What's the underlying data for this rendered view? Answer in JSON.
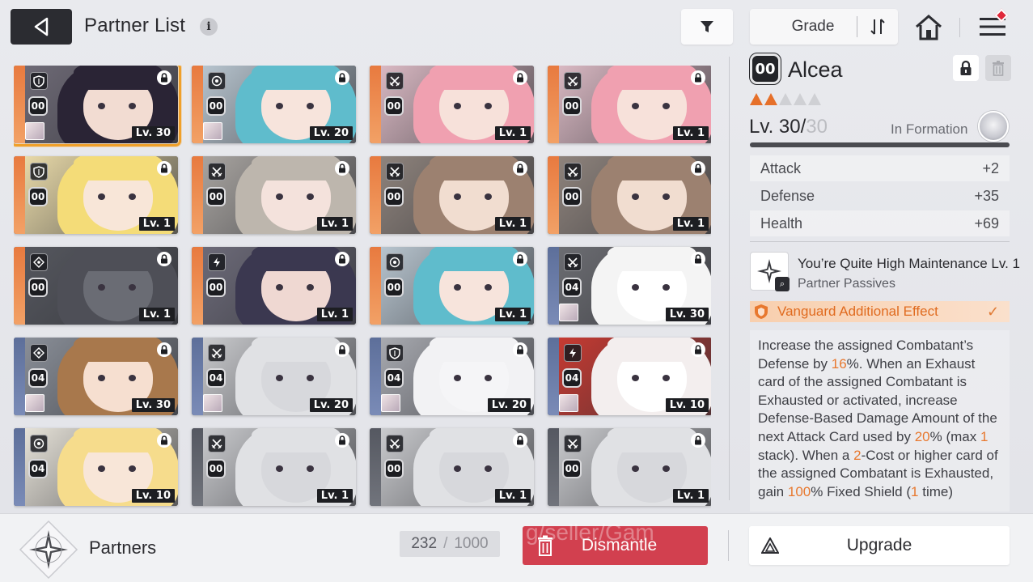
{
  "header": {
    "title": "Partner List",
    "info_glyph": "i",
    "sort_label": "Grade"
  },
  "colors": {
    "accent_orange": "#e8782e",
    "selected_outline": "#f0a02a",
    "dismantle_red": "#d2404f",
    "dark": "#2b2c31"
  },
  "grid": {
    "cards": [
      {
        "class_icon": "shield-icon",
        "grade": "00",
        "level": "Lv. 30",
        "locked": true,
        "selected": true,
        "strip": "orange",
        "avatar": true,
        "hair": "#2a2435",
        "skin": "#f2dcd2",
        "bg": "#6e6a76"
      },
      {
        "class_icon": "target-icon",
        "grade": "00",
        "level": "Lv. 20",
        "locked": true,
        "selected": false,
        "strip": "orange",
        "avatar": true,
        "hair": "#5fbccc",
        "skin": "#f7e4dc",
        "bg": "#b7c4ce"
      },
      {
        "class_icon": "swords-icon",
        "grade": "00",
        "level": "Lv. 1",
        "locked": true,
        "selected": false,
        "strip": "orange",
        "avatar": false,
        "hair": "#f0a0b0",
        "skin": "#f7e1da",
        "bg": "#d9b8c2"
      },
      {
        "class_icon": "swords-icon",
        "grade": "00",
        "level": "Lv. 1",
        "locked": true,
        "selected": false,
        "strip": "orange",
        "avatar": false,
        "hair": "#f0a0b0",
        "skin": "#f7e1da",
        "bg": "#d9b8c2"
      },
      {
        "class_icon": "shield-icon",
        "grade": "00",
        "level": "Lv. 1",
        "locked": true,
        "selected": false,
        "strip": "orange",
        "avatar": false,
        "hair": "#f4dc78",
        "skin": "#f8e6d8",
        "bg": "#e8d9a8"
      },
      {
        "class_icon": "swords-icon",
        "grade": "00",
        "level": "Lv. 1",
        "locked": true,
        "selected": false,
        "strip": "orange",
        "avatar": false,
        "hair": "#bdb6ad",
        "skin": "#f4e2dc",
        "bg": "#a8a4a0"
      },
      {
        "class_icon": "swords-icon",
        "grade": "00",
        "level": "Lv. 1",
        "locked": true,
        "selected": false,
        "strip": "orange",
        "avatar": false,
        "hair": "#9c8170",
        "skin": "#f1ddd0",
        "bg": "#8e837c"
      },
      {
        "class_icon": "swords-icon",
        "grade": "00",
        "level": "Lv. 1",
        "locked": true,
        "selected": false,
        "strip": "orange",
        "avatar": false,
        "hair": "#9c8170",
        "skin": "#f1ddd0",
        "bg": "#8e837c"
      },
      {
        "class_icon": "crosshair-icon",
        "grade": "00",
        "level": "Lv. 1",
        "locked": true,
        "selected": false,
        "strip": "orange",
        "avatar": false,
        "hair": "#4e4f57",
        "skin": "#6a6c74",
        "bg": "#55575e"
      },
      {
        "class_icon": "lightning-icon",
        "grade": "00",
        "level": "Lv. 1",
        "locked": true,
        "selected": false,
        "strip": "orange",
        "avatar": false,
        "hair": "#3b3850",
        "skin": "#efd8d2",
        "bg": "#6c6a78"
      },
      {
        "class_icon": "target-icon",
        "grade": "00",
        "level": "Lv. 1",
        "locked": true,
        "selected": false,
        "strip": "orange",
        "avatar": false,
        "hair": "#5fbccc",
        "skin": "#f7e4dc",
        "bg": "#b7c4ce"
      },
      {
        "class_icon": "swords-icon",
        "grade": "04",
        "level": "Lv. 30",
        "locked": true,
        "selected": false,
        "strip": "blue",
        "avatar": true,
        "hair": "#f4f4f4",
        "skin": "#ffffff",
        "bg": "#6c6d72"
      },
      {
        "class_icon": "crosshair-icon",
        "grade": "04",
        "level": "Lv. 30",
        "locked": true,
        "selected": false,
        "strip": "blue",
        "avatar": true,
        "hair": "#a8784c",
        "skin": "#f6dfd0",
        "bg": "#8a8f98"
      },
      {
        "class_icon": "swords-icon",
        "grade": "04",
        "level": "Lv. 20",
        "locked": true,
        "selected": false,
        "strip": "blue",
        "avatar": true,
        "hair": "#e0e1e4",
        "skin": "#d7d8dc",
        "bg": "#c9cacd"
      },
      {
        "class_icon": "shield-icon",
        "grade": "04",
        "level": "Lv. 20",
        "locked": true,
        "selected": false,
        "strip": "blue",
        "avatar": true,
        "hair": "#f2f2f4",
        "skin": "#f5f5f7",
        "bg": "#a8aab0"
      },
      {
        "class_icon": "lightning-icon",
        "grade": "04",
        "level": "Lv. 10",
        "locked": true,
        "selected": false,
        "strip": "blue",
        "avatar": true,
        "hair": "#f3eeee",
        "skin": "#ffffff",
        "bg": "#c63a32"
      },
      {
        "class_icon": "target-icon",
        "grade": "04",
        "level": "Lv. 10",
        "locked": true,
        "selected": false,
        "strip": "blue",
        "avatar": false,
        "hair": "#f6dc8c",
        "skin": "#f8e6d8",
        "bg": "#e6e2d8"
      },
      {
        "class_icon": "swords-icon",
        "grade": "00",
        "level": "Lv. 1",
        "locked": true,
        "selected": false,
        "strip": "gray",
        "avatar": false,
        "hair": "#e0e1e4",
        "skin": "#d7d8dc",
        "bg": "#c9cacd"
      },
      {
        "class_icon": "swords-icon",
        "grade": "00",
        "level": "Lv. 1",
        "locked": true,
        "selected": false,
        "strip": "gray",
        "avatar": false,
        "hair": "#e0e1e4",
        "skin": "#d7d8dc",
        "bg": "#c9cacd"
      },
      {
        "class_icon": "swords-icon",
        "grade": "00",
        "level": "Lv. 1",
        "locked": true,
        "selected": false,
        "strip": "gray",
        "avatar": false,
        "hair": "#e0e1e4",
        "skin": "#d7d8dc",
        "bg": "#c9cacd"
      }
    ]
  },
  "detail": {
    "grade": "00",
    "name": "Alcea",
    "stars_filled": 2,
    "stars_total": 5,
    "level_current": "Lv. 30/",
    "level_max": "30",
    "xp_fraction": 1.0,
    "formation_label": "In Formation",
    "stats": [
      {
        "label": "Attack",
        "value": "+2"
      },
      {
        "label": "Defense",
        "value": "+35"
      },
      {
        "label": "Health",
        "value": "+69"
      }
    ],
    "passive_title": "You’re Quite High Maintenance Lv. 1",
    "passive_sub": "Partner Passives",
    "vanguard_label": "Vanguard Additional Effect",
    "vanguard_check": "✓",
    "description": [
      {
        "t": "Increase the assigned Combatant’s Defense by ",
        "h": false
      },
      {
        "t": "16",
        "h": true
      },
      {
        "t": "%. When an Exhaust card of the assigned Combatant is Exhausted or activated, increase Defense-Based Damage Amount of the next Attack Card used by ",
        "h": false
      },
      {
        "t": "20",
        "h": true
      },
      {
        "t": "% (max ",
        "h": false
      },
      {
        "t": "1",
        "h": true
      },
      {
        "t": " stack). When a ",
        "h": false
      },
      {
        "t": "2",
        "h": true
      },
      {
        "t": "-Cost or higher card of the assigned Combatant is Exhausted, gain ",
        "h": false
      },
      {
        "t": "100",
        "h": true
      },
      {
        "t": "% Fixed Shield (",
        "h": false
      },
      {
        "t": "1",
        "h": true
      },
      {
        "t": " time)",
        "h": false
      }
    ]
  },
  "bottom": {
    "section_label": "Partners",
    "count_current": "232",
    "count_sep": "/",
    "count_max": "1000",
    "dismantle_label": "Dismantle",
    "upgrade_label": "Upgrade",
    "watermark": "g/seller/Gam"
  }
}
